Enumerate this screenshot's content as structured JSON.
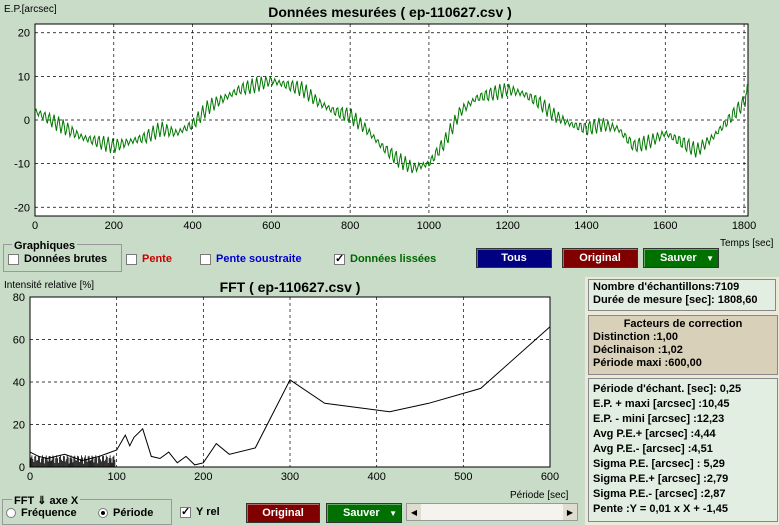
{
  "top_chart": {
    "title": "Données mesurées ( ep-110627.csv )",
    "ylabel": "E.P.[arcsec]",
    "xlabel": "Temps [sec]",
    "yticks": [
      "20",
      "10",
      "0",
      "-10",
      "-20"
    ],
    "xticks": [
      "0",
      "200",
      "400",
      "600",
      "800",
      "1000",
      "1200",
      "1400",
      "1600",
      "1800"
    ]
  },
  "graphiques": {
    "label": "Graphiques",
    "options": [
      {
        "label": "Données brutes",
        "checked": false,
        "color": "#000000"
      },
      {
        "label": "Pente",
        "checked": false,
        "color": "#cc0000"
      },
      {
        "label": "Pente soustraite",
        "checked": false,
        "color": "#0000cc"
      },
      {
        "label": "Données lissées",
        "checked": true,
        "color": "#006600"
      }
    ],
    "btn_tous": "Tous",
    "btn_original": "Original",
    "btn_sauver": "Sauver"
  },
  "fft_chart": {
    "title": "FFT ( ep-110627.csv )",
    "ylabel": "Intensité relative [%]",
    "xlabel": "Période [sec]",
    "yticks": [
      "80",
      "60",
      "40",
      "20",
      "0"
    ],
    "xticks": [
      "0",
      "100",
      "200",
      "300",
      "400",
      "500",
      "600"
    ]
  },
  "fft_controls": {
    "group_label": "FFT ⇓ axe X",
    "radio_freq": "Fréquence",
    "radio_period": "Période",
    "period_selected": true,
    "yrel_label": "Y rel",
    "yrel_checked": true,
    "btn_original": "Original",
    "btn_sauver": "Sauver"
  },
  "info1": {
    "rows": [
      "Nombre d'échantillons:7109",
      "Durée de mesure [sec]: 1808,60"
    ]
  },
  "info2": {
    "title": "Facteurs de correction",
    "rows": [
      "Distinction :1,00",
      "Déclinaison :1,02",
      "Période maxi :600,00"
    ]
  },
  "info3": {
    "rows": [
      "Période d'échant. [sec]: 0,25",
      "E.P. + maxi [arcsec] :10,45",
      "E.P. - mini [arcsec] :12,23",
      "Avg P.E.+ [arcsec] :4,44",
      "Avg P.E.- [arcsec] :4,51",
      "Sigma P.E. [arcsec] : 5,29",
      "Sigma P.E.+ [arcsec] :2,79",
      "Sigma P.E.- [arcsec] :2,87",
      "Pente :Y = 0,01 x X + -1,45"
    ]
  },
  "colors": {
    "curve_green": "#007700",
    "btn_blue": "#000080",
    "btn_red": "#800000",
    "btn_green": "#007000"
  },
  "chart_data": [
    {
      "type": "line",
      "title": "Données mesurées ( ep-110627.csv )",
      "xlabel": "Temps [sec]",
      "ylabel": "E.P.[arcsec]",
      "xlim": [
        0,
        1810
      ],
      "ylim": [
        -22,
        22
      ],
      "grid": true,
      "series": [
        {
          "name": "Données lissées",
          "x": [
            0,
            40,
            80,
            120,
            160,
            200,
            240,
            280,
            320,
            360,
            400,
            440,
            480,
            520,
            560,
            600,
            640,
            680,
            720,
            760,
            800,
            840,
            880,
            920,
            960,
            1000,
            1040,
            1080,
            1120,
            1160,
            1200,
            1240,
            1280,
            1320,
            1360,
            1400,
            1440,
            1480,
            1520,
            1560,
            1600,
            1640,
            1680,
            1720,
            1760,
            1800,
            1810
          ],
          "y": [
            2,
            0,
            -2,
            -4,
            -5,
            -6,
            -5,
            -4,
            -2,
            -3,
            -1,
            3,
            5,
            7,
            8,
            9,
            8,
            7,
            4,
            2,
            1,
            -2,
            -6,
            -9,
            -11,
            -10,
            -5,
            2,
            5,
            6,
            7,
            6,
            4,
            1,
            -1,
            -2,
            -1,
            -2,
            -6,
            -5,
            -3,
            -5,
            -7,
            -4,
            0,
            4,
            7
          ]
        }
      ]
    },
    {
      "type": "line",
      "title": "FFT ( ep-110627.csv )",
      "xlabel": "Période [sec]",
      "ylabel": "Intensité relative [%]",
      "xlim": [
        0,
        600
      ],
      "ylim": [
        0,
        80
      ],
      "grid": true,
      "series": [
        {
          "name": "FFT",
          "x": [
            0,
            10,
            20,
            40,
            60,
            80,
            100,
            110,
            115,
            120,
            130,
            140,
            150,
            160,
            170,
            180,
            190,
            200,
            215,
            230,
            260,
            300,
            340,
            415,
            460,
            520,
            600
          ],
          "y": [
            7,
            5,
            4,
            6,
            3,
            5,
            8,
            15,
            10,
            14,
            18,
            5,
            4,
            7,
            2,
            5,
            1,
            2,
            11,
            6,
            9,
            41,
            30,
            26,
            30,
            37,
            66
          ]
        }
      ]
    }
  ]
}
